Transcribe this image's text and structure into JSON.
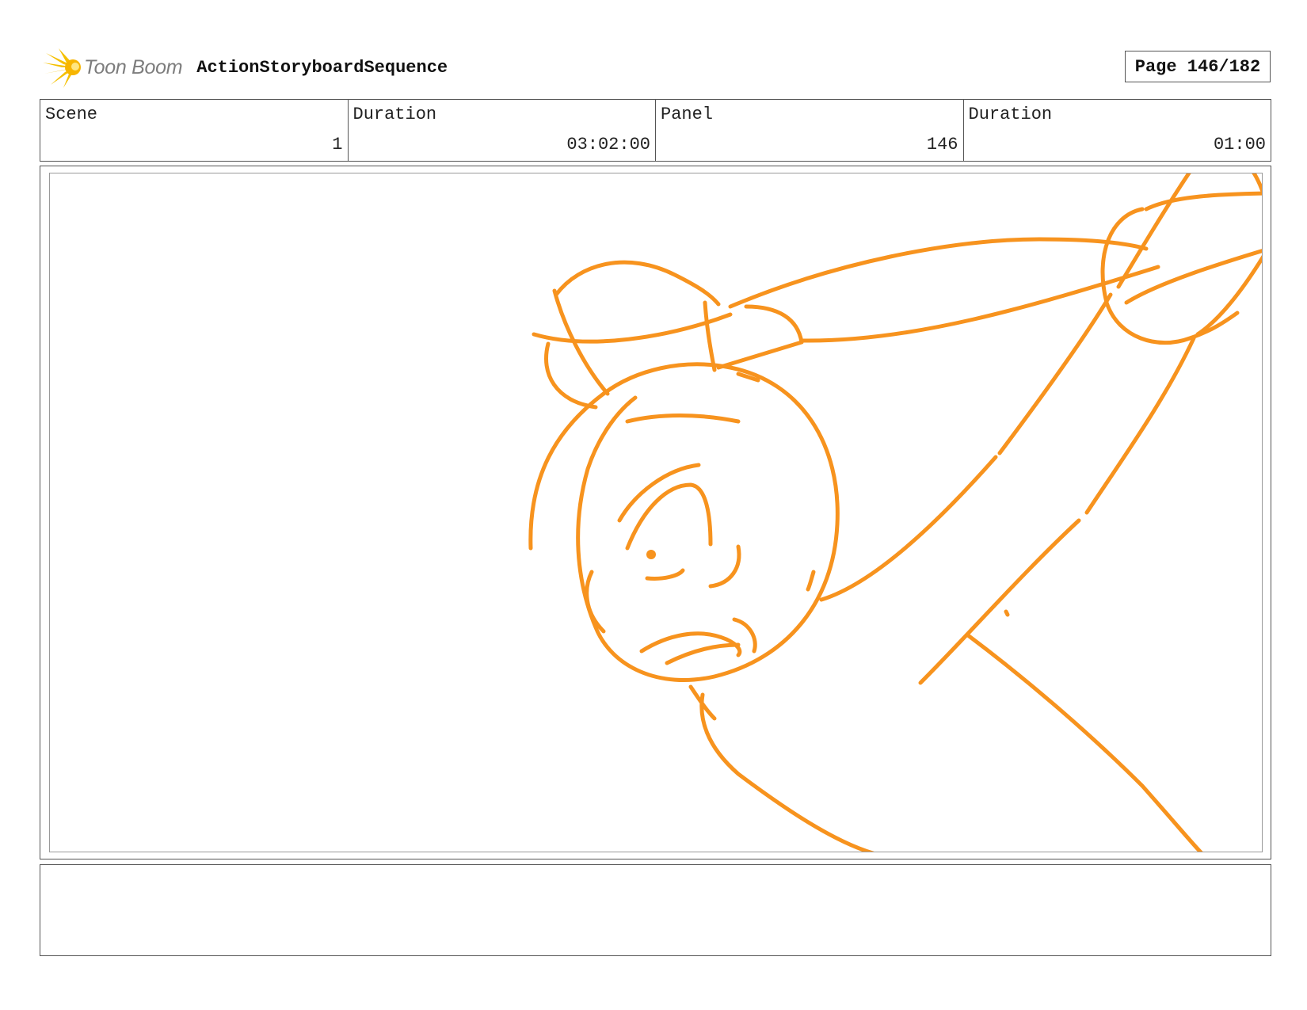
{
  "header": {
    "logo_text": "Toon Boom",
    "title": "ActionStoryboardSequence",
    "page_label": "Page 146/182"
  },
  "info": {
    "scene_label": "Scene",
    "scene_value": "1",
    "scene_duration_label": "Duration",
    "scene_duration_value": "03:02:00",
    "panel_label": "Panel",
    "panel_value": "146",
    "panel_duration_label": "Duration",
    "panel_duration_value": "01:00"
  },
  "panel": {
    "sketch_color": "#f7931e",
    "subject": "character-sketch"
  },
  "notes": {
    "text": ""
  },
  "colors": {
    "border": "#555555",
    "inner_border": "#9a9a9a",
    "logo_yellow": "#f5c000",
    "logo_gray": "#7d7d7d"
  }
}
